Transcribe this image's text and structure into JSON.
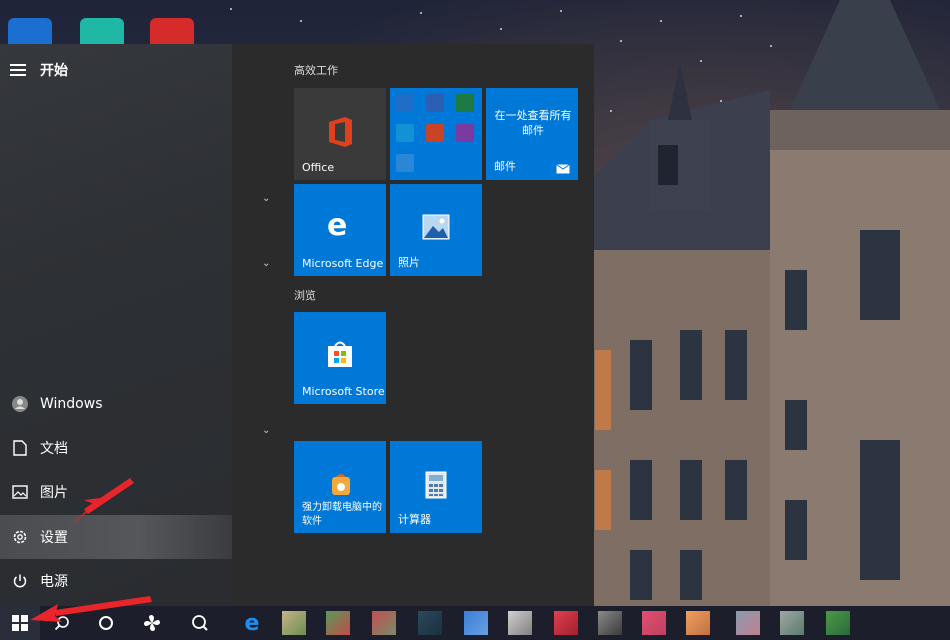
{
  "start_menu": {
    "title": "开始",
    "left_items": [
      {
        "label": "Windows",
        "icon": "user-icon"
      },
      {
        "label": "文档",
        "icon": "document-icon"
      },
      {
        "label": "图片",
        "icon": "pictures-icon"
      },
      {
        "label": "设置",
        "icon": "gear-icon"
      },
      {
        "label": "电源",
        "icon": "power-icon"
      }
    ]
  },
  "tiles": {
    "groups": [
      "高效工作",
      "浏览"
    ],
    "office": "Office",
    "mail_text": "在一处查看所有邮件",
    "mail": "邮件",
    "edge": "Microsoft Edge",
    "photos": "照片",
    "store": "Microsoft Store",
    "uninstaller": "强力卸载电脑中的软件",
    "calculator": "计算器"
  },
  "colors": {
    "tile_blue": "#0078d7",
    "annotation_red": "#e8252a"
  }
}
